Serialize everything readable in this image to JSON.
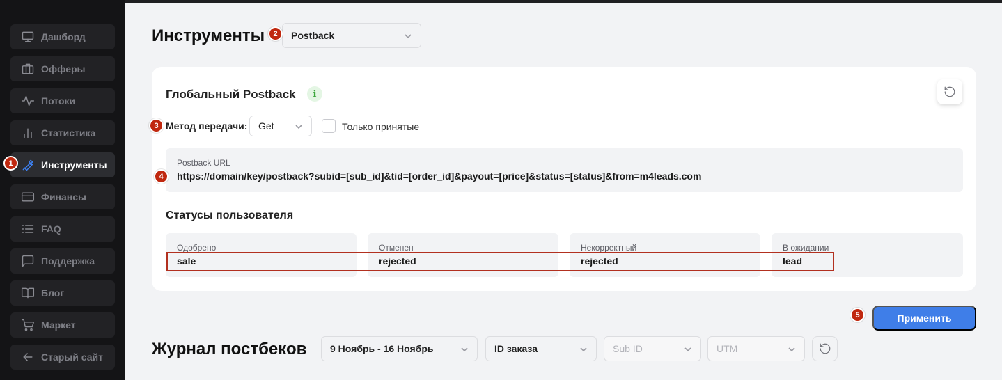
{
  "sidebar": {
    "items": [
      {
        "label": "Дашборд",
        "icon": "monitor-icon"
      },
      {
        "label": "Офферы",
        "icon": "briefcase-icon"
      },
      {
        "label": "Потоки",
        "icon": "activity-icon"
      },
      {
        "label": "Статистика",
        "icon": "bar-chart-icon"
      },
      {
        "label": "Инструменты",
        "icon": "wrench-icon",
        "active": true
      },
      {
        "label": "Финансы",
        "icon": "credit-card-icon"
      },
      {
        "label": "FAQ",
        "icon": "list-icon"
      },
      {
        "label": "Поддержка",
        "icon": "message-icon"
      },
      {
        "label": "Блог",
        "icon": "book-icon"
      },
      {
        "label": "Маркет",
        "icon": "cart-icon"
      },
      {
        "label": "Старый сайт",
        "icon": "arrow-left-icon"
      }
    ]
  },
  "header": {
    "title": "Инструменты",
    "tool_select": "Postback"
  },
  "postback_card": {
    "title": "Глобальный Postback",
    "method_label": "Метод передачи:",
    "method_value": "Get",
    "only_accepted_label": "Только принятые",
    "url_label": "Postback URL",
    "url_value": "https://domain/key/postback?subid=[sub_id]&tid=[order_id]&payout=[price]&status=[status]&from=m4leads.com",
    "statuses_title": "Статусы пользователя",
    "statuses": [
      {
        "label": "Одобрено",
        "value": "sale"
      },
      {
        "label": "Отменен",
        "value": "rejected"
      },
      {
        "label": "Некорректный",
        "value": "rejected"
      },
      {
        "label": "В ожидании",
        "value": "lead"
      }
    ]
  },
  "apply_label": "Применить",
  "journal": {
    "title": "Журнал постбеков",
    "date_range": "9 Ноябрь - 16 Ноябрь",
    "order_filter": "ID заказа",
    "subid_filter": "Sub ID",
    "utm_filter": "UTM"
  },
  "markers": [
    "1",
    "2",
    "3",
    "4",
    "5"
  ],
  "colors": {
    "sidebar_bg": "#141416",
    "accent": "#3f7ee8",
    "marker": "#c0280f",
    "highlight_border": "#b2301f"
  }
}
